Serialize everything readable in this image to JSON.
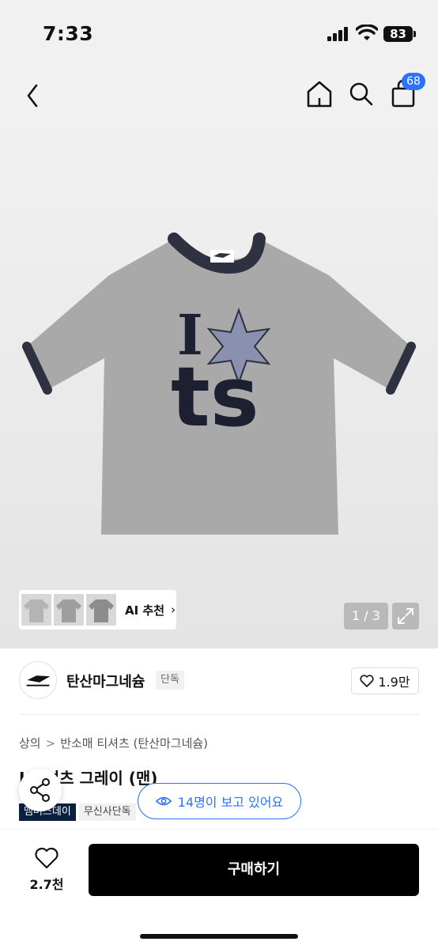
{
  "status_bar": {
    "time": "7:33",
    "battery": "83"
  },
  "nav": {
    "cart_count": "68",
    "icons": [
      "back-chevron-icon",
      "home-icon",
      "search-icon",
      "shopping-bag-icon"
    ]
  },
  "hero": {
    "shirt_print": {
      "line1_letter": "I",
      "line2": "ts"
    },
    "colors": {
      "shirt": "#a9a9a9",
      "trim": "#2d3140",
      "background": "#ececec"
    },
    "recommend": {
      "label": "AI 추천",
      "chevron": "›"
    },
    "page_indicator": "1 / 3"
  },
  "brand": {
    "name": "탄산마그네슘",
    "tag": "단독",
    "likes": "1.9만"
  },
  "breadcrumb": {
    "level1": "상의",
    "separator": ">",
    "level2": "반소매 티셔츠 (탄산마그네슘)"
  },
  "product": {
    "title": "I    티셔츠 그레이 (맨)",
    "tags": [
      "맴버스데이",
      "무신사단독"
    ]
  },
  "viewers": {
    "text": "14명이 보고 있어요"
  },
  "bottom": {
    "wish_count": "2.7천",
    "buy_label": "구매하기"
  },
  "colors": {
    "accent": "#2a72ff",
    "buy_button": "#000000",
    "member_tag": "#0b2040"
  }
}
